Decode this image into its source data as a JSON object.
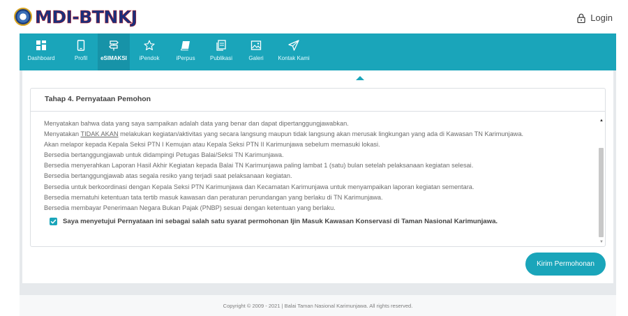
{
  "header": {
    "logo_text": "MDI-BTNKJ",
    "login_label": "Login"
  },
  "nav": {
    "items": [
      {
        "label": "Dashboard",
        "icon": "dashboard-icon",
        "active": false
      },
      {
        "label": "Profil",
        "icon": "phone-icon",
        "active": false
      },
      {
        "label": "eSIMAKSI",
        "icon": "signpost-icon",
        "active": true
      },
      {
        "label": "iPendok",
        "icon": "star-icon",
        "active": false
      },
      {
        "label": "iPerpus",
        "icon": "book-icon",
        "active": false
      },
      {
        "label": "Publikasi",
        "icon": "document-icon",
        "active": false
      },
      {
        "label": "Galeri",
        "icon": "image-icon",
        "active": false
      },
      {
        "label": "Kontak Kami",
        "icon": "send-icon",
        "active": false
      }
    ]
  },
  "step": {
    "title": "Tahap 4. Pernyataan Pemohon",
    "statements": [
      "Menyatakan bahwa data yang saya sampaikan adalah data yang benar dan dapat dipertanggungjawabkan.",
      "Menyatakan ",
      "TIDAK AKAN",
      " melakukan kegiatan/aktivitas yang secara langsung maupun tidak langsung akan merusak lingkungan yang ada di Kawasan TN Karimunjawa.",
      "Akan melapor kepada Kepala Seksi PTN I Kemujan atau Kepala Seksi PTN II Karimunjawa sebelum memasuki lokasi.",
      "Bersedia bertanggungjawab untuk didampingi Petugas Balai/Seksi TN Karimunjawa.",
      "Bersedia menyerahkan Laporan Hasil Akhir Kegiatan kepada Balai TN Karimunjawa paling lambat 1 (satu) bulan setelah pelaksanaan kegiatan selesai.",
      "Bersedia bertanggungjawab atas segala resiko yang terjadi saat pelaksanaan kegiatan.",
      "Bersedia untuk berkoordinasi dengan Kepala Seksi PTN Karimunjawa dan Kecamatan Karimunjawa untuk menyampaikan laporan kegiatan sementara.",
      "Bersedia mematuhi ketentuan tata tertib masuk kawasan dan peraturan perundangan yang berlaku di TN Karimunjawa.",
      "Bersedia membayar Penerimaan Negara Bukan Pajak (PNBP) sesuai dengan ketentuan yang berlaku."
    ],
    "agreement_label": "Saya menyetujui Pernyataan ini sebagai salah satu syarat permohonan Ijin Masuk Kawasan Konservasi di Taman Nasional Karimunjawa.",
    "agreement_checked": true,
    "submit_label": "Kirim Permohonan"
  },
  "footer": {
    "text": "Copyright © 2009 - 2021 | Balai Taman Nasional Karimunjawa. All rights reserved."
  },
  "colors": {
    "accent": "#1aa5ba",
    "nav_active": "#1793a8",
    "page_bg": "#e6e9ec"
  }
}
